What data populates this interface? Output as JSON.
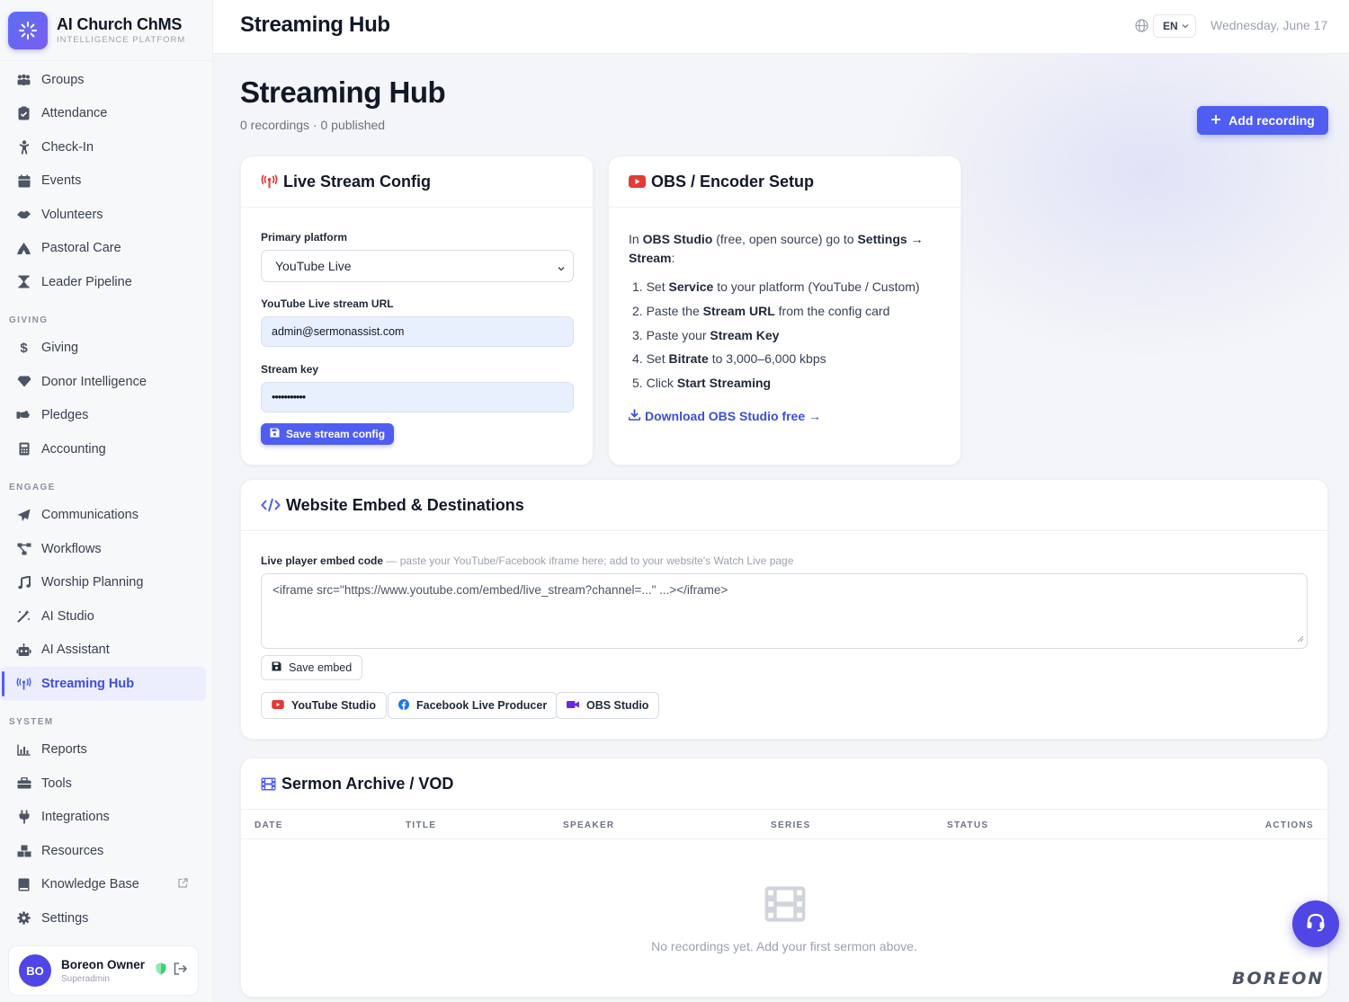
{
  "brand": {
    "title": "AI Church ChMS",
    "subtitle": "INTELLIGENCE PLATFORM"
  },
  "sidebar": {
    "items_top": [
      {
        "label": "Groups",
        "icon": "groups-icon"
      },
      {
        "label": "Attendance",
        "icon": "clipboard-check-icon"
      },
      {
        "label": "Check-In",
        "icon": "child-icon"
      },
      {
        "label": "Events",
        "icon": "calendar-icon"
      },
      {
        "label": "Volunteers",
        "icon": "handshake-icon"
      },
      {
        "label": "Pastoral Care",
        "icon": "praying-hands-icon"
      },
      {
        "label": "Leader Pipeline",
        "icon": "hourglass-icon"
      }
    ],
    "section_giving": "GIVING",
    "items_giving": [
      {
        "label": "Giving",
        "icon": "dollar-icon"
      },
      {
        "label": "Donor Intelligence",
        "icon": "gem-icon"
      },
      {
        "label": "Pledges",
        "icon": "hand-coins-icon"
      },
      {
        "label": "Accounting",
        "icon": "calculator-icon"
      }
    ],
    "section_engage": "ENGAGE",
    "items_engage": [
      {
        "label": "Communications",
        "icon": "paper-plane-icon"
      },
      {
        "label": "Workflows",
        "icon": "workflow-icon"
      },
      {
        "label": "Worship Planning",
        "icon": "music-note-icon"
      },
      {
        "label": "AI Studio",
        "icon": "magic-wand-icon"
      },
      {
        "label": "AI Assistant",
        "icon": "robot-icon"
      },
      {
        "label": "Streaming Hub",
        "icon": "broadcast-icon",
        "active": true
      }
    ],
    "section_system": "SYSTEM",
    "items_system": [
      {
        "label": "Reports",
        "icon": "bar-chart-icon"
      },
      {
        "label": "Tools",
        "icon": "toolbox-icon"
      },
      {
        "label": "Integrations",
        "icon": "plug-icon"
      },
      {
        "label": "Resources",
        "icon": "boxes-icon"
      },
      {
        "label": "Knowledge Base",
        "icon": "book-icon"
      },
      {
        "label": "Settings",
        "icon": "gear-icon"
      }
    ],
    "user": {
      "initials": "BO",
      "name": "Boreon Owner",
      "role": "Superadmin"
    }
  },
  "topbar": {
    "title": "Streaming Hub",
    "language": "EN",
    "date": "Wednesday, June 17"
  },
  "page": {
    "title": "Streaming Hub",
    "subtitle": "0 recordings · 0 published",
    "add_button": "Add recording"
  },
  "live_config": {
    "title": "Live Stream Config",
    "platform_label": "Primary platform",
    "platform_value": "YouTube Live",
    "url_label": "YouTube Live stream URL",
    "url_value": "admin@sermonassist.com",
    "key_label": "Stream key",
    "key_value": "•••••••••••",
    "save_button": "Save stream config"
  },
  "obs": {
    "title": "OBS / Encoder Setup",
    "intro_1": "In ",
    "intro_obs": "OBS Studio",
    "intro_2": " (free, open source) go to ",
    "intro_settings": "Settings →",
    "intro_stream": "Stream",
    "intro_3": ":",
    "steps": [
      {
        "num": "1.",
        "pre": "Set ",
        "bold": "Service",
        "post": " to your platform (YouTube / Custom)"
      },
      {
        "num": "2.",
        "pre": "Paste the ",
        "bold": "Stream URL",
        "post": " from the config card"
      },
      {
        "num": "3.",
        "pre": "Paste your ",
        "bold": "Stream Key",
        "post": ""
      },
      {
        "num": "4.",
        "pre": "Set ",
        "bold": "Bitrate",
        "post": " to 3,000–6,000 kbps"
      },
      {
        "num": "5.",
        "pre": "Click ",
        "bold": "Start Streaming",
        "post": ""
      }
    ],
    "download_link": "Download OBS Studio free →"
  },
  "embed": {
    "title": "Website Embed & Destinations",
    "label": "Live player embed code",
    "label_hint": " — paste your YouTube/Facebook iframe here; add to your website's Watch Live page",
    "placeholder": "<iframe src=\"https://www.youtube.com/embed/live_stream?channel=...\" ...></iframe>",
    "save_button": "Save embed",
    "destinations": [
      "YouTube Studio",
      "Facebook Live Producer",
      "OBS Studio"
    ]
  },
  "archive": {
    "title": "Sermon Archive / VOD",
    "columns": [
      "DATE",
      "TITLE",
      "SPEAKER",
      "SERIES",
      "STATUS",
      "ACTIONS"
    ],
    "empty_text": "No recordings yet. Add your first sermon above."
  },
  "watermark": "BOREON",
  "colors": {
    "accent": "#4f5ef0",
    "youtube_red": "#e53935",
    "facebook_blue": "#1877f2",
    "obs_purple": "#6d28d9"
  }
}
